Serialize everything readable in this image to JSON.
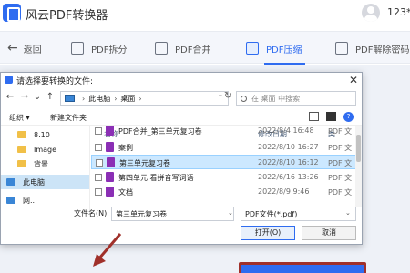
{
  "app": {
    "title": "风云PDF转换器",
    "user_name": "123*"
  },
  "nav": {
    "back_label": "返回",
    "items": [
      {
        "label": "PDF拆分"
      },
      {
        "label": "PDF合并"
      },
      {
        "label": "PDF压缩"
      },
      {
        "label": "PDF解除密码"
      }
    ],
    "active_index": 2
  },
  "dialog": {
    "title": "请选择要转换的文件:",
    "breadcrumb": [
      "此电脑",
      "桌面"
    ],
    "search_placeholder": "在 桌面 中搜索",
    "cmd_organize": "组织 ▾",
    "cmd_new_folder": "新建文件夹",
    "tree": [
      {
        "label": "8.10"
      },
      {
        "label": "Image"
      },
      {
        "label": "背景"
      },
      {
        "label": "此电脑"
      },
      {
        "label": "网..."
      }
    ],
    "columns": {
      "name": "名称",
      "date": "修改日期",
      "type": "类"
    },
    "files": [
      {
        "name": "PDF合并_第三单元复习卷",
        "date": "2022/8/4 16:48",
        "type": "PDF 文"
      },
      {
        "name": "案例",
        "date": "2022/8/10 16:27",
        "type": "PDF 文"
      },
      {
        "name": "第三单元复习卷",
        "date": "2022/8/10 16:12",
        "type": "PDF 文"
      },
      {
        "name": "第四单元 看拼音写词语",
        "date": "2022/6/16 13:26",
        "type": "PDF 文"
      },
      {
        "name": "文档",
        "date": "2022/8/9 9:46",
        "type": "PDF 文"
      }
    ],
    "selected_index": 2,
    "filename_label": "文件名(N):",
    "filename_value": "第三单元复习卷",
    "filter_value": "PDF文件(*.pdf)",
    "open_label": "打开(O)",
    "cancel_label": "取消"
  },
  "colors": {
    "accent": "#2f6cf0",
    "annotation_red": "#a0302a",
    "pdf_icon": "#8b2fb5"
  }
}
